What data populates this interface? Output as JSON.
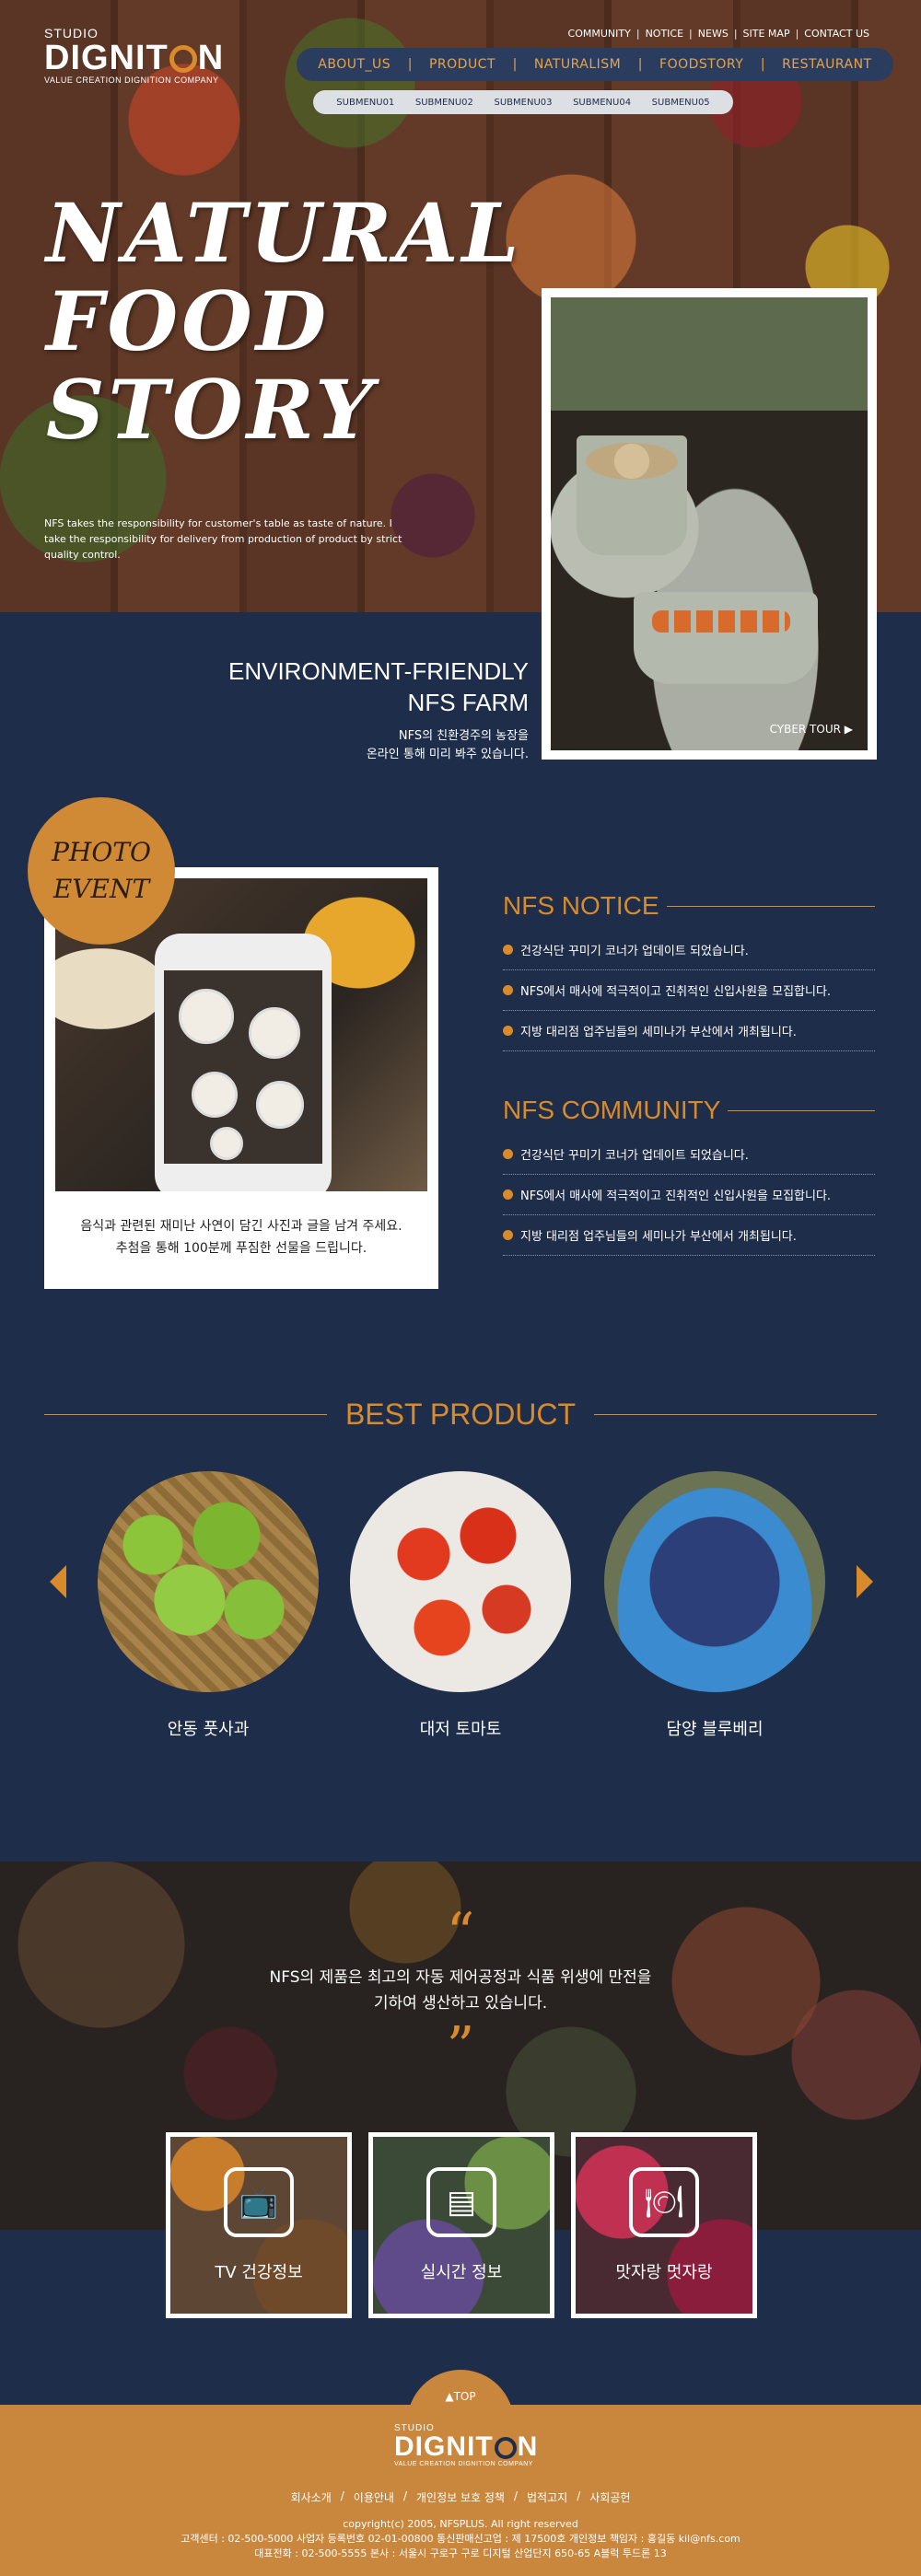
{
  "header": {
    "logo_studio": "STUDIO",
    "logo_main_1": "DIGNIT",
    "logo_main_2": "N",
    "logo_sub": "VALUE CREATION DIGNITION COMPANY",
    "util_links": [
      "COMMUNITY",
      "NOTICE",
      "NEWS",
      "SITE MAP",
      "CONTACT US"
    ],
    "nav": [
      "ABOUT_US",
      "PRODUCT",
      "NATURALISM",
      "FOODSTORY",
      "RESTAURANT"
    ],
    "submenu": [
      "SUBMENU01",
      "SUBMENU02",
      "SUBMENU03",
      "SUBMENU04",
      "SUBMENU05"
    ]
  },
  "hero": {
    "title_lines": [
      "NATURAL",
      "FOOD",
      "STORY"
    ],
    "desc": "NFS takes the responsibility for customer's table as taste of nature. I take the responsibility for delivery from production of product by strict quality control.",
    "farm_title_1": "ENVIRONMENT-FRIENDLY",
    "farm_title_2": "NFS FARM",
    "farm_desc_1": "NFS의 친환경주의 농장을",
    "farm_desc_2": "온라인 통해 미리 봐주 있습니다.",
    "tour_label": "CYBER TOUR ▶"
  },
  "event": {
    "badge_1": "PHOTO",
    "badge_2": "EVENT",
    "text_1": "음식과 관련된 재미난 사연이 담긴 사진과 글을 남겨 주세요.",
    "text_2": "추첨을 통해 100분께 푸짐한 선물을 드립니다."
  },
  "notice": {
    "title": "NFS NOTICE",
    "items": [
      "건강식단 꾸미기 코너가 업데이트 되었습니다.",
      "NFS에서 매사에 적극적이고 진취적인 신입사원을 모집합니다.",
      "지방 대리점 업주님들의 세미나가 부산에서 개최됩니다."
    ]
  },
  "community": {
    "title": "NFS COMMUNITY",
    "items": [
      "건강식단 꾸미기 코너가 업데이트 되었습니다.",
      "NFS에서 매사에 적극적이고 진취적인 신입사원을 모집합니다.",
      "지방 대리점 업주님들의 세미나가 부산에서 개최됩니다."
    ]
  },
  "best": {
    "title": "BEST PRODUCT",
    "products": [
      "안동 풋사과",
      "대저 토마토",
      "담양 블루베리"
    ]
  },
  "quote": {
    "line_1": "NFS의 제품은 최고의 자동 제어공정과 식품 위생에 만전을",
    "line_2": "기하여 생산하고 있습니다.",
    "tiles": [
      "TV 건강정보",
      "실시간 정보",
      "맛자랑 멋자랑"
    ]
  },
  "footer": {
    "top_label": "▲TOP",
    "links": [
      "회사소개",
      "이용안내",
      "개인정보 보호 정책",
      "법적고지",
      "사회공헌"
    ],
    "copyright": "copyright(c) 2005, NFSPLUS. All right reserved",
    "info_1": "고객센터 : 02-500-5000    사업자 등록번호 02-01-00800    통신판매신고업 : 제 17500호  개인정보 책임자 : 홍길동 kil@nfs.com",
    "info_2": "대표전화 : 02-500-5555   본사 : 서울시 구로구 구로 디지털 산업단지 650-65 A블럭 투드론 13"
  },
  "colors": {
    "navy": "#1d2d4a",
    "orange": "#d98b2b",
    "footer": "#c9873e"
  }
}
